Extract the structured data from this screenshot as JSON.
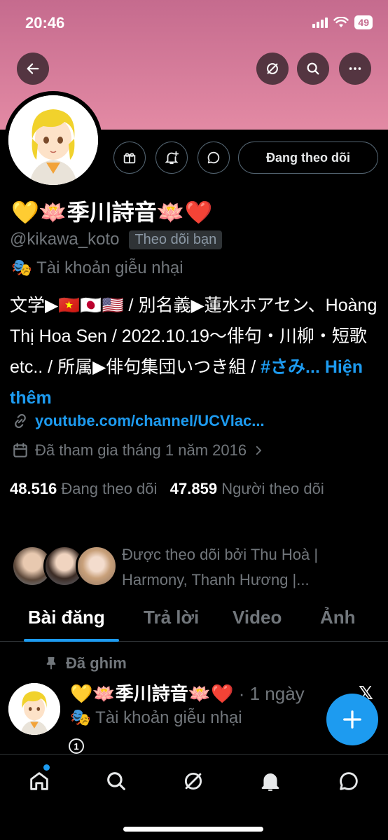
{
  "status_bar": {
    "time": "20:46",
    "battery": "49"
  },
  "header": {
    "back_icon": "arrow-left-icon",
    "grok_icon": "grok-icon",
    "search_icon": "search-icon",
    "more_icon": "more-horizontal-icon"
  },
  "profile": {
    "name": "💛🪷季川詩音🪷❤️",
    "handle": "@kikawa_koto",
    "follows_you": "Theo dõi bạn",
    "parody_label": "🎭 Tài khoản giễu nhại",
    "follow_button": "Đang theo dõi",
    "bio": "文学▶🇻🇳🇯🇵🇺🇸 / 別名義▶蓮水ホアセン、Hoàng Thị Hoa Sen / 2022.10.19〜俳句・川柳・短歌etc.. / 所属▶俳句集団いつき組 / ",
    "bio_hashtag": "#さみ...",
    "bio_more": "Hiện thêm",
    "link": "youtube.com/channel/UCVlac...",
    "joined": "Đã tham gia tháng 1 năm 2016",
    "following_count": "48.516",
    "following_label": "Đang theo dõi",
    "followers_count": "47.859",
    "followers_label": "Người theo dõi",
    "followed_by": "Được theo dõi bởi Thu Hoà | Harmony, Thanh Hương |..."
  },
  "tabs": [
    {
      "label": "Bài đăng"
    },
    {
      "label": "Trả lời"
    },
    {
      "label": "Video"
    },
    {
      "label": "Ảnh"
    }
  ],
  "post": {
    "pinned": "Đã ghim",
    "name": "💛🪷季川詩音🪷❤️",
    "time": " · 1 ngày",
    "parody_label": "🎭 Tài khoản giễu nhại",
    "x_label": "𝕏",
    "badge": "1"
  },
  "colors": {
    "accent": "#1d9bf0",
    "banner": "#e38aa4",
    "muted": "#71767b"
  }
}
